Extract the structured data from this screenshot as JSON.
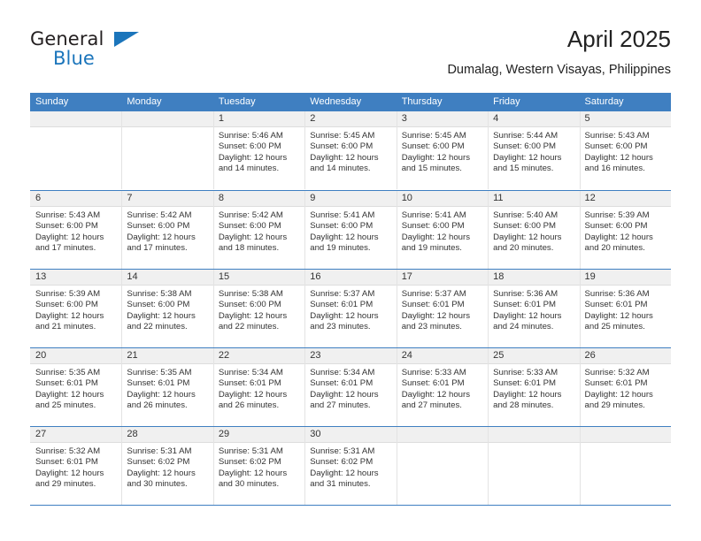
{
  "brand": {
    "name_part1": "General",
    "name_part2": "Blue",
    "flag_icon": "blue-triangle-flag-icon"
  },
  "header": {
    "title": "April 2025",
    "subtitle": "Dumalag, Western Visayas, Philippines"
  },
  "colors": {
    "header_blue": "#3f7fc1",
    "brand_blue": "#1b75bb",
    "day_band_gray": "#f0f0f0",
    "text": "#333333"
  },
  "weekday_headers": [
    "Sunday",
    "Monday",
    "Tuesday",
    "Wednesday",
    "Thursday",
    "Friday",
    "Saturday"
  ],
  "weeks": [
    [
      {
        "day": "",
        "sunrise": "",
        "sunset": "",
        "daylight_line1": "",
        "daylight_line2": ""
      },
      {
        "day": "",
        "sunrise": "",
        "sunset": "",
        "daylight_line1": "",
        "daylight_line2": ""
      },
      {
        "day": "1",
        "sunrise": "Sunrise: 5:46 AM",
        "sunset": "Sunset: 6:00 PM",
        "daylight_line1": "Daylight: 12 hours",
        "daylight_line2": "and 14 minutes."
      },
      {
        "day": "2",
        "sunrise": "Sunrise: 5:45 AM",
        "sunset": "Sunset: 6:00 PM",
        "daylight_line1": "Daylight: 12 hours",
        "daylight_line2": "and 14 minutes."
      },
      {
        "day": "3",
        "sunrise": "Sunrise: 5:45 AM",
        "sunset": "Sunset: 6:00 PM",
        "daylight_line1": "Daylight: 12 hours",
        "daylight_line2": "and 15 minutes."
      },
      {
        "day": "4",
        "sunrise": "Sunrise: 5:44 AM",
        "sunset": "Sunset: 6:00 PM",
        "daylight_line1": "Daylight: 12 hours",
        "daylight_line2": "and 15 minutes."
      },
      {
        "day": "5",
        "sunrise": "Sunrise: 5:43 AM",
        "sunset": "Sunset: 6:00 PM",
        "daylight_line1": "Daylight: 12 hours",
        "daylight_line2": "and 16 minutes."
      }
    ],
    [
      {
        "day": "6",
        "sunrise": "Sunrise: 5:43 AM",
        "sunset": "Sunset: 6:00 PM",
        "daylight_line1": "Daylight: 12 hours",
        "daylight_line2": "and 17 minutes."
      },
      {
        "day": "7",
        "sunrise": "Sunrise: 5:42 AM",
        "sunset": "Sunset: 6:00 PM",
        "daylight_line1": "Daylight: 12 hours",
        "daylight_line2": "and 17 minutes."
      },
      {
        "day": "8",
        "sunrise": "Sunrise: 5:42 AM",
        "sunset": "Sunset: 6:00 PM",
        "daylight_line1": "Daylight: 12 hours",
        "daylight_line2": "and 18 minutes."
      },
      {
        "day": "9",
        "sunrise": "Sunrise: 5:41 AM",
        "sunset": "Sunset: 6:00 PM",
        "daylight_line1": "Daylight: 12 hours",
        "daylight_line2": "and 19 minutes."
      },
      {
        "day": "10",
        "sunrise": "Sunrise: 5:41 AM",
        "sunset": "Sunset: 6:00 PM",
        "daylight_line1": "Daylight: 12 hours",
        "daylight_line2": "and 19 minutes."
      },
      {
        "day": "11",
        "sunrise": "Sunrise: 5:40 AM",
        "sunset": "Sunset: 6:00 PM",
        "daylight_line1": "Daylight: 12 hours",
        "daylight_line2": "and 20 minutes."
      },
      {
        "day": "12",
        "sunrise": "Sunrise: 5:39 AM",
        "sunset": "Sunset: 6:00 PM",
        "daylight_line1": "Daylight: 12 hours",
        "daylight_line2": "and 20 minutes."
      }
    ],
    [
      {
        "day": "13",
        "sunrise": "Sunrise: 5:39 AM",
        "sunset": "Sunset: 6:00 PM",
        "daylight_line1": "Daylight: 12 hours",
        "daylight_line2": "and 21 minutes."
      },
      {
        "day": "14",
        "sunrise": "Sunrise: 5:38 AM",
        "sunset": "Sunset: 6:00 PM",
        "daylight_line1": "Daylight: 12 hours",
        "daylight_line2": "and 22 minutes."
      },
      {
        "day": "15",
        "sunrise": "Sunrise: 5:38 AM",
        "sunset": "Sunset: 6:00 PM",
        "daylight_line1": "Daylight: 12 hours",
        "daylight_line2": "and 22 minutes."
      },
      {
        "day": "16",
        "sunrise": "Sunrise: 5:37 AM",
        "sunset": "Sunset: 6:01 PM",
        "daylight_line1": "Daylight: 12 hours",
        "daylight_line2": "and 23 minutes."
      },
      {
        "day": "17",
        "sunrise": "Sunrise: 5:37 AM",
        "sunset": "Sunset: 6:01 PM",
        "daylight_line1": "Daylight: 12 hours",
        "daylight_line2": "and 23 minutes."
      },
      {
        "day": "18",
        "sunrise": "Sunrise: 5:36 AM",
        "sunset": "Sunset: 6:01 PM",
        "daylight_line1": "Daylight: 12 hours",
        "daylight_line2": "and 24 minutes."
      },
      {
        "day": "19",
        "sunrise": "Sunrise: 5:36 AM",
        "sunset": "Sunset: 6:01 PM",
        "daylight_line1": "Daylight: 12 hours",
        "daylight_line2": "and 25 minutes."
      }
    ],
    [
      {
        "day": "20",
        "sunrise": "Sunrise: 5:35 AM",
        "sunset": "Sunset: 6:01 PM",
        "daylight_line1": "Daylight: 12 hours",
        "daylight_line2": "and 25 minutes."
      },
      {
        "day": "21",
        "sunrise": "Sunrise: 5:35 AM",
        "sunset": "Sunset: 6:01 PM",
        "daylight_line1": "Daylight: 12 hours",
        "daylight_line2": "and 26 minutes."
      },
      {
        "day": "22",
        "sunrise": "Sunrise: 5:34 AM",
        "sunset": "Sunset: 6:01 PM",
        "daylight_line1": "Daylight: 12 hours",
        "daylight_line2": "and 26 minutes."
      },
      {
        "day": "23",
        "sunrise": "Sunrise: 5:34 AM",
        "sunset": "Sunset: 6:01 PM",
        "daylight_line1": "Daylight: 12 hours",
        "daylight_line2": "and 27 minutes."
      },
      {
        "day": "24",
        "sunrise": "Sunrise: 5:33 AM",
        "sunset": "Sunset: 6:01 PM",
        "daylight_line1": "Daylight: 12 hours",
        "daylight_line2": "and 27 minutes."
      },
      {
        "day": "25",
        "sunrise": "Sunrise: 5:33 AM",
        "sunset": "Sunset: 6:01 PM",
        "daylight_line1": "Daylight: 12 hours",
        "daylight_line2": "and 28 minutes."
      },
      {
        "day": "26",
        "sunrise": "Sunrise: 5:32 AM",
        "sunset": "Sunset: 6:01 PM",
        "daylight_line1": "Daylight: 12 hours",
        "daylight_line2": "and 29 minutes."
      }
    ],
    [
      {
        "day": "27",
        "sunrise": "Sunrise: 5:32 AM",
        "sunset": "Sunset: 6:01 PM",
        "daylight_line1": "Daylight: 12 hours",
        "daylight_line2": "and 29 minutes."
      },
      {
        "day": "28",
        "sunrise": "Sunrise: 5:31 AM",
        "sunset": "Sunset: 6:02 PM",
        "daylight_line1": "Daylight: 12 hours",
        "daylight_line2": "and 30 minutes."
      },
      {
        "day": "29",
        "sunrise": "Sunrise: 5:31 AM",
        "sunset": "Sunset: 6:02 PM",
        "daylight_line1": "Daylight: 12 hours",
        "daylight_line2": "and 30 minutes."
      },
      {
        "day": "30",
        "sunrise": "Sunrise: 5:31 AM",
        "sunset": "Sunset: 6:02 PM",
        "daylight_line1": "Daylight: 12 hours",
        "daylight_line2": "and 31 minutes."
      },
      {
        "day": "",
        "sunrise": "",
        "sunset": "",
        "daylight_line1": "",
        "daylight_line2": ""
      },
      {
        "day": "",
        "sunrise": "",
        "sunset": "",
        "daylight_line1": "",
        "daylight_line2": ""
      },
      {
        "day": "",
        "sunrise": "",
        "sunset": "",
        "daylight_line1": "",
        "daylight_line2": ""
      }
    ]
  ]
}
